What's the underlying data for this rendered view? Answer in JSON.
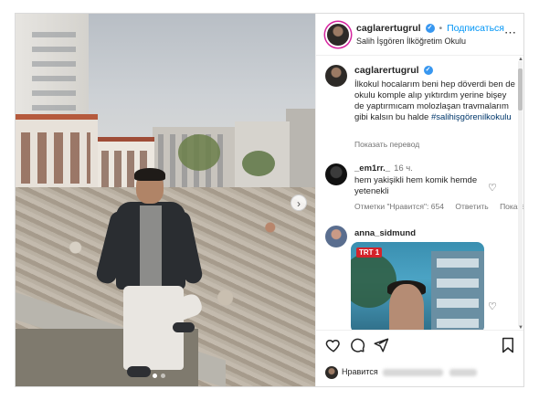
{
  "header": {
    "username": "caglarertugrul",
    "separator": "•",
    "follow_label": "Подписаться",
    "location": "Salih İşgören İlköğretim Okulu",
    "more_icon": "⋯"
  },
  "caption": {
    "username": "caglarertugrul",
    "text": "İlkokul hocalarım beni hep döverdi ben de okulu komple alıp yıktırdım yerine bişey de yaptırmıcam molozlaşan travmalarım gibi kalsın bu halde",
    "hashtag": "#salihişgörenilkokulu",
    "translate_label": "Показать перевод"
  },
  "comments": [
    {
      "username": "_em1rr._",
      "time": "16 ч.",
      "text": "hem yakişikli hem komik hemde yetenekli",
      "meta_tag": "Отметки \"Нравится\": 654",
      "meta_reply": "Ответить",
      "meta_translate": "Показат"
    },
    {
      "username": "anna_sidmund",
      "media_badge": "TRT 1"
    }
  ],
  "likes": {
    "prefix": "Нравится"
  },
  "colors": {
    "accent": "#0095f6",
    "verified": "#3897f0",
    "text": "#262626",
    "muted": "#737373",
    "hashtag": "#00376b"
  },
  "icons": {
    "verified": "✓",
    "next": "›",
    "heart": "♡",
    "scroll_up": "▲",
    "scroll_down": "▼"
  }
}
